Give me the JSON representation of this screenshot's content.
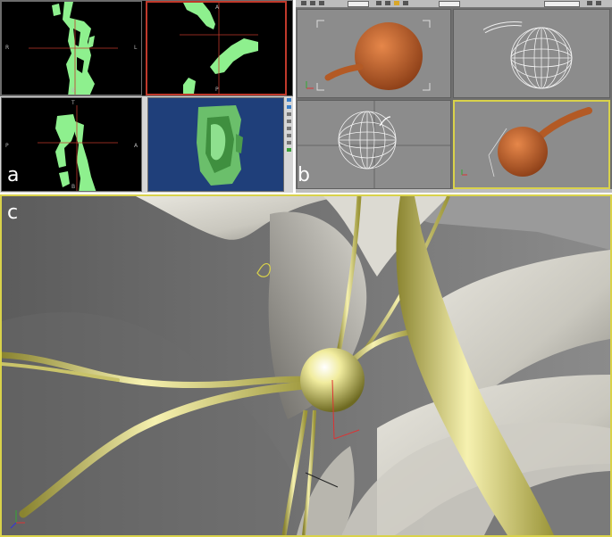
{
  "labels": {
    "a": "a",
    "b": "b",
    "c": "c"
  },
  "panel_a": {
    "views": [
      {
        "id": "top-left",
        "left": "R",
        "right": "L",
        "bottom": "B"
      },
      {
        "id": "top-right",
        "top": "A",
        "bottom": "P"
      },
      {
        "id": "bottom-left",
        "left": "P",
        "right": "A",
        "top": "T",
        "bottom": "B"
      }
    ]
  },
  "colors": {
    "ct_green": "#8ef08e",
    "ct_background": "#000000",
    "active_border": "#c0392b",
    "render_blue": "#1f3f7a",
    "sphere_orange": "#c8642a",
    "nerve_yellow": "#e8e27a",
    "frame_yellow": "#d9d24a",
    "tissue_gray": "#8f8f8f"
  },
  "icons": [
    "axis-tripod-icon",
    "selection-bracket-icon",
    "toolbar-icons"
  ]
}
